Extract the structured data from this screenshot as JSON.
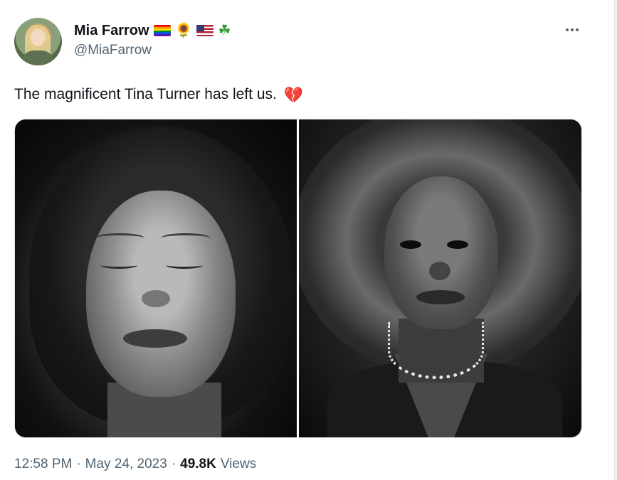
{
  "author": {
    "display_name": "Mia Farrow",
    "handle": "@MiaFarrow",
    "name_emojis": [
      "rainbow-flag",
      "sunflower",
      "us-flag",
      "shamrock"
    ]
  },
  "tweet": {
    "text": "The magnificent Tina Turner has left us.",
    "text_emoji": "💔",
    "time": "12:58 PM",
    "separator": "·",
    "date": "May 24, 2023",
    "views_count": "49.8K",
    "views_label": "Views"
  },
  "media": {
    "photo_count": 2
  },
  "colors": {
    "primary_text": "#0f1419",
    "secondary_text": "#536471",
    "heart": "#d3203c"
  },
  "icons": {
    "more": "more-horizontal-icon",
    "heart": "broken-heart-icon"
  }
}
